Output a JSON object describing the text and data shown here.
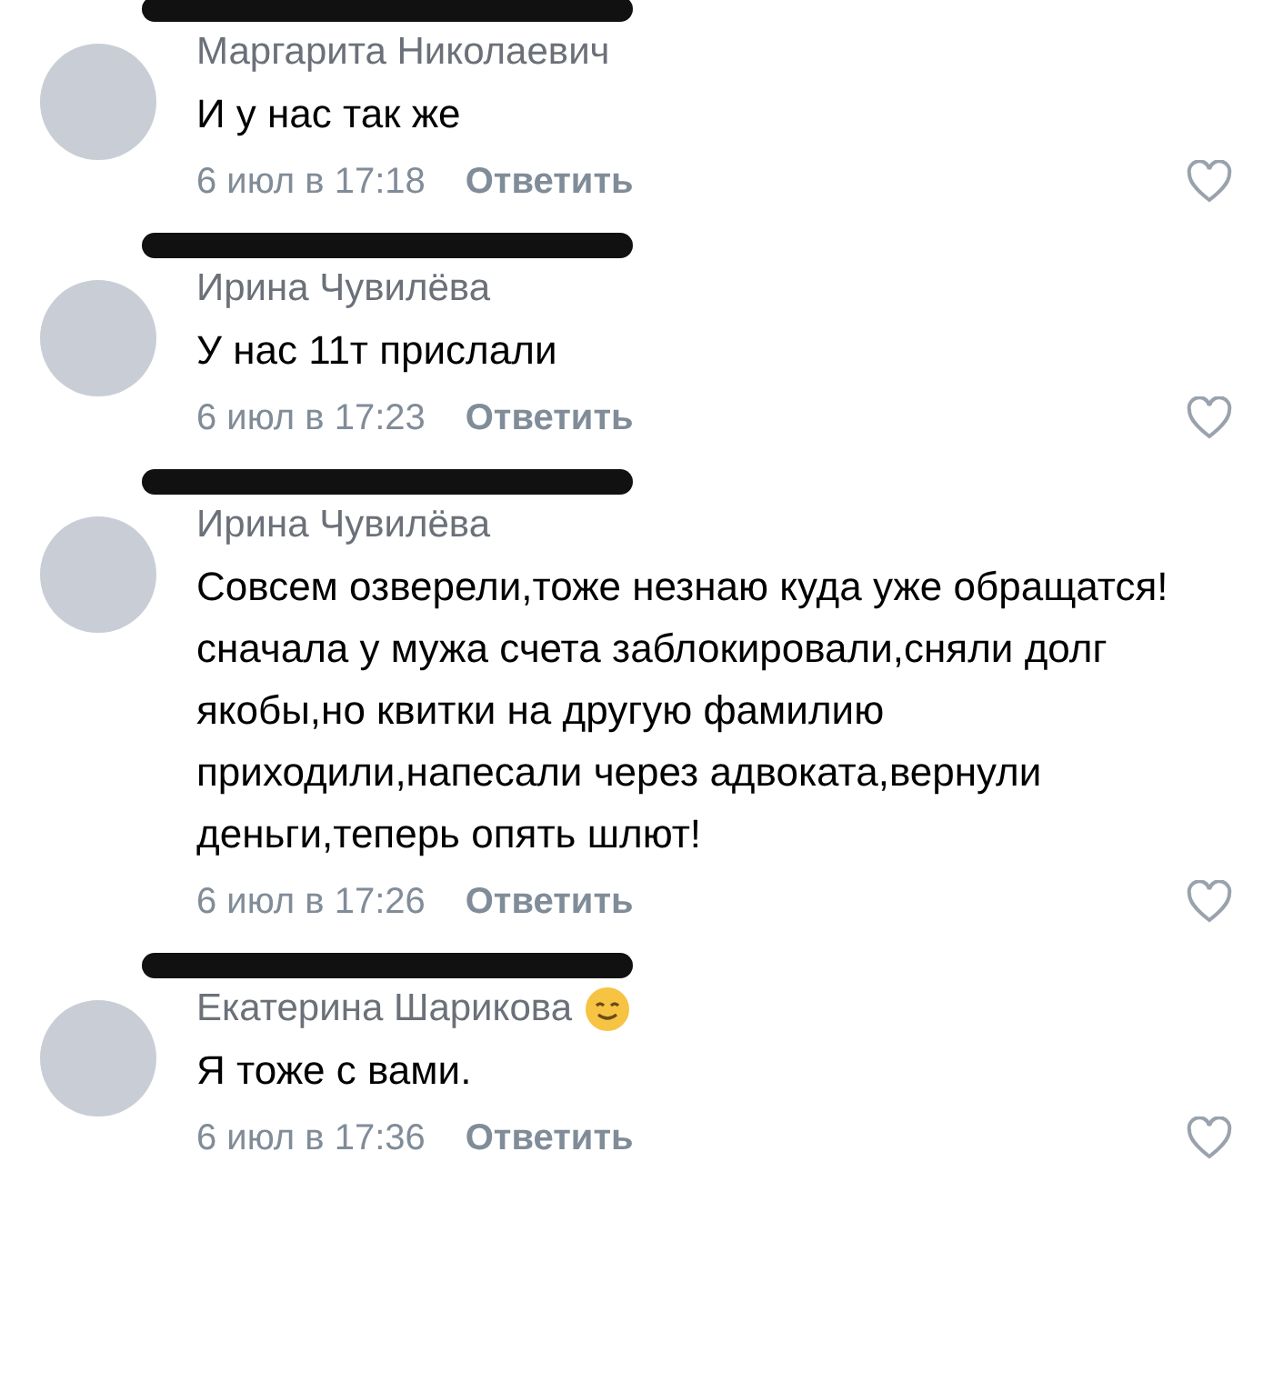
{
  "comments": [
    {
      "author": "Маргарита Николаевич",
      "text": "И у нас так же",
      "date": "6 июл в 17:18",
      "reply": "Ответить",
      "emoji": false
    },
    {
      "author": "Ирина Чувилёва",
      "text": "У нас 11т прислали",
      "date": "6 июл в 17:23",
      "reply": "Ответить",
      "emoji": false
    },
    {
      "author": "Ирина Чувилёва",
      "text": "Совсем озверели,тоже незнаю куда уже обращатся!сначала у мужа счета заблокировали,сняли долг якобы,но квитки на другую фамилию приходили,напесали через адвоката,вернули деньги,теперь опять шлют!",
      "date": "6 июл в 17:26",
      "reply": "Ответить",
      "emoji": false
    },
    {
      "author": "Екатерина Шарикова",
      "text": "Я тоже с вами.",
      "date": "6 июл в 17:36",
      "reply": "Ответить",
      "emoji": true
    }
  ]
}
